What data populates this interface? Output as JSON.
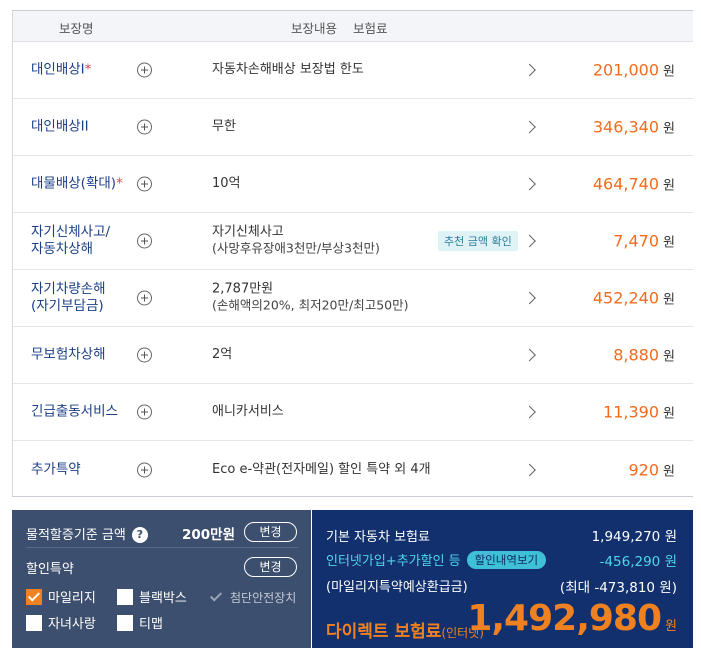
{
  "header": {
    "col_name": "보장명",
    "col_content": "보장내용",
    "col_premium": "보험료"
  },
  "rows": [
    {
      "name": "대인배상I",
      "star": "*",
      "desc": "자동차손해배상 보장법 한도",
      "sub": "",
      "badge": "",
      "value": "201,000",
      "unit": "원"
    },
    {
      "name": "대인배상II",
      "star": "",
      "desc": "무한",
      "sub": "",
      "badge": "",
      "value": "346,340",
      "unit": "원"
    },
    {
      "name": "대물배상(확대)",
      "star": "*",
      "desc": "10억",
      "sub": "",
      "badge": "",
      "value": "464,740",
      "unit": "원"
    },
    {
      "name": "자기신체사고/",
      "name2": "자동차상해",
      "star": "",
      "desc": "자기신체사고",
      "sub": "(사망후유장애3천만/부상3천만)",
      "badge": "추천 금액 확인",
      "value": "7,470",
      "unit": "원"
    },
    {
      "name": "자기차량손해",
      "name2": "(자기부담금)",
      "star": "",
      "desc": "2,787만원",
      "sub": "(손해액의20%, 최저20만/최고50만)",
      "badge": "",
      "value": "452,240",
      "unit": "원"
    },
    {
      "name": "무보험차상해",
      "star": "",
      "desc": "2억",
      "sub": "",
      "badge": "",
      "value": "8,880",
      "unit": "원"
    },
    {
      "name": "긴급출동서비스",
      "star": "",
      "desc": "애니카서비스",
      "sub": "",
      "badge": "",
      "value": "11,390",
      "unit": "원"
    },
    {
      "name": "추가특약",
      "star": "",
      "desc": "Eco e-약관(전자메일) 할인 특약 외 4개",
      "sub": "",
      "badge": "",
      "value": "920",
      "unit": "원"
    }
  ],
  "left_panel": {
    "property_label": "물적할증기준 금액",
    "help_icon": "?",
    "property_amount": "200만원",
    "change_label": "변경",
    "discount_label": "할인특약",
    "discount_change_label": "변경",
    "checkboxes": {
      "mileage": "마일리지",
      "blackbox": "블랙박스",
      "safety": "첨단안전장치",
      "child": "자녀사랑",
      "tmap": "티맵"
    }
  },
  "right_panel": {
    "basic_label": "기본 자동차 보험료",
    "basic_value": "1,949,270",
    "discount_label": "인터넷가입+추가할인 등",
    "discount_detail_btn": "할인내역보기",
    "discount_value": "-456,290",
    "mileage_label": "(마일리지특약예상환급금)",
    "mileage_value": "(최대 -473,810 원)",
    "final_label": "다이렉트 보험료",
    "final_label_small": "(인터넷)",
    "final_value": "1,492,980",
    "unit": "원"
  },
  "colors": {
    "accent_orange": "#f08121",
    "premium_orange": "#f26b1d",
    "navy": "#12306e",
    "slate": "#3d4f6e",
    "cyan": "#4fd6e8"
  }
}
